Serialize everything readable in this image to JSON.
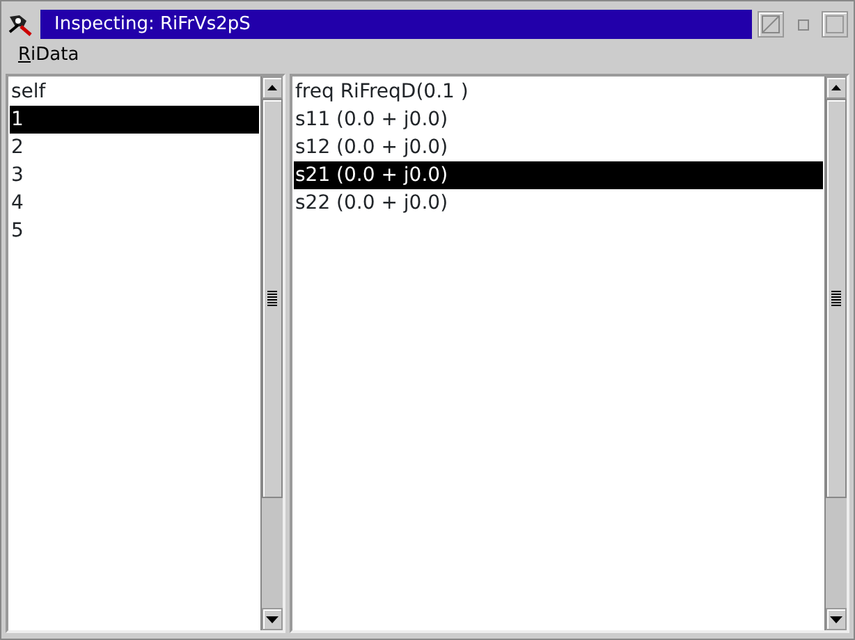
{
  "window": {
    "title": "Inspecting: RiFrVs2pS"
  },
  "menu": [
    {
      "label": "RiData",
      "first_letter_underlined": true
    }
  ],
  "fields_list": {
    "items": [
      {
        "label": "self",
        "selected": false
      },
      {
        "label": "1",
        "selected": true
      },
      {
        "label": "2",
        "selected": false
      },
      {
        "label": "3",
        "selected": false
      },
      {
        "label": "4",
        "selected": false
      },
      {
        "label": "5",
        "selected": false
      }
    ]
  },
  "values_list": {
    "items": [
      {
        "label": "freq RiFreqD(0.1 )",
        "selected": false
      },
      {
        "label": "s11 (0.0 + j0.0)",
        "selected": false
      },
      {
        "label": "s12 (0.0 + j0.0)",
        "selected": false
      },
      {
        "label": "s21 (0.0 + j0.0)",
        "selected": true
      },
      {
        "label": "s22 (0.0 + j0.0)",
        "selected": false
      }
    ]
  }
}
